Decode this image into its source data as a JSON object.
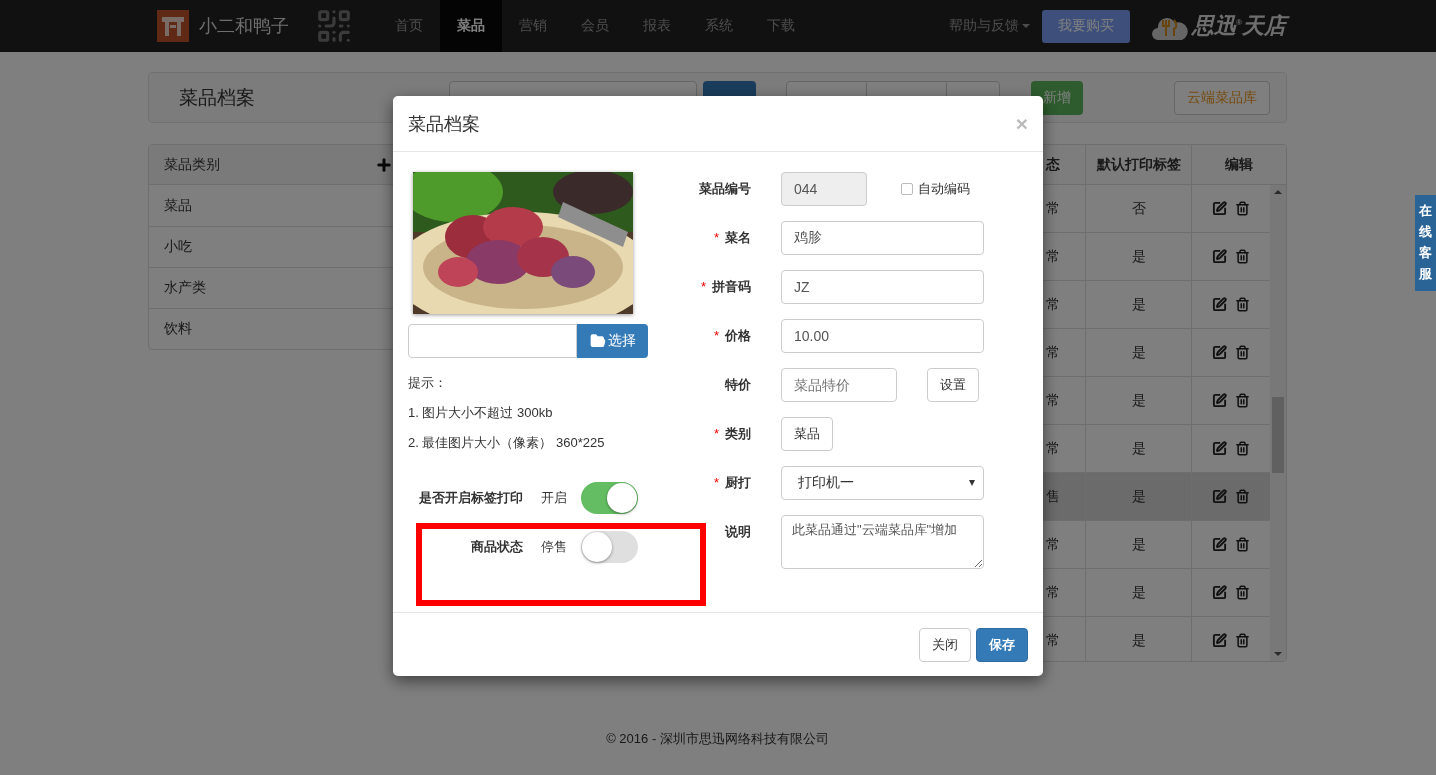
{
  "navbar": {
    "brand": "小二和鸭子",
    "items": [
      {
        "label": "首页",
        "selected": false
      },
      {
        "label": "菜品",
        "selected": true
      },
      {
        "label": "营销",
        "selected": false
      },
      {
        "label": "会员",
        "selected": false
      },
      {
        "label": "报表",
        "selected": false
      },
      {
        "label": "系统",
        "selected": false
      },
      {
        "label": "下载",
        "selected": false
      }
    ],
    "help": "帮助与反馈",
    "buy_button": "我要购买",
    "logo_text": "思迅$^{®}$天店"
  },
  "toolbar": {
    "title": "菜品档案",
    "add_button": "新增",
    "cloud_button": "云端菜品库"
  },
  "sidebar": {
    "title": "菜品类别",
    "items": [
      "菜品",
      "小吃",
      "水产类",
      "饮料"
    ]
  },
  "table": {
    "columns": [
      "态",
      "默认打印标签",
      "编辑"
    ],
    "rows": [
      {
        "status": "常",
        "print_label": "否",
        "selected": false
      },
      {
        "status": "常",
        "print_label": "是",
        "selected": false
      },
      {
        "status": "常",
        "print_label": "是",
        "selected": false
      },
      {
        "status": "常",
        "print_label": "是",
        "selected": false
      },
      {
        "status": "常",
        "print_label": "是",
        "selected": false
      },
      {
        "status": "常",
        "print_label": "是",
        "selected": false
      },
      {
        "status": "售",
        "print_label": "是",
        "selected": true
      },
      {
        "status": "常",
        "print_label": "是",
        "selected": false
      },
      {
        "status": "常",
        "print_label": "是",
        "selected": false
      },
      {
        "status": "常",
        "print_label": "是",
        "selected": false
      }
    ]
  },
  "dialog": {
    "title": "菜品档案",
    "close": "×",
    "choose_button": "选择",
    "hints": [
      "提示：",
      "1. 图片大小不超过 300kb",
      "2. 最佳图片大小（像素） 360*225"
    ],
    "toggles": [
      {
        "label": "是否开启标签打印",
        "state_text": "开启",
        "on": true
      },
      {
        "label": "商品状态",
        "state_text": "停售",
        "on": false
      }
    ],
    "fields": [
      {
        "label": "菜品编号",
        "kind": "readonly",
        "value": "044",
        "checkbox": {
          "label": "自动编码",
          "checked": false
        }
      },
      {
        "label": "菜名",
        "mark": "*",
        "kind": "text",
        "value": "鸡胗"
      },
      {
        "label": "拼音码",
        "mark": "*",
        "kind": "text",
        "value": "JZ"
      },
      {
        "label": "价格",
        "mark": "*",
        "kind": "text",
        "value": "10.00"
      },
      {
        "label": "特价",
        "kind": "input_button",
        "placeholder": "菜品特价",
        "button": "设置"
      },
      {
        "label": "类别",
        "mark": "*",
        "kind": "button",
        "value": "菜品"
      },
      {
        "label": "厨打",
        "mark": "*",
        "kind": "select",
        "value": "打印机一"
      },
      {
        "label": "说明",
        "kind": "textarea",
        "value": "此菜品通过\"云端菜品库\"增加"
      }
    ],
    "buttons": [
      {
        "label": "关闭",
        "kind": "default"
      },
      {
        "label": "保存",
        "kind": "primary"
      }
    ]
  },
  "footer": "© 2016 - 深圳市思迅网络科技有限公司",
  "side_tab": "在线客服"
}
